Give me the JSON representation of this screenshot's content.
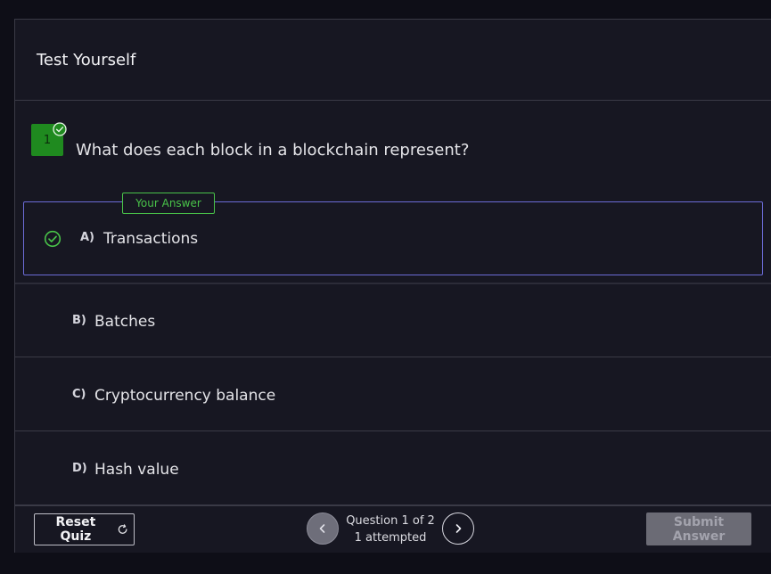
{
  "quiz": {
    "title": "Test Yourself"
  },
  "question": {
    "number": "1",
    "text": "What does each block in a blockchain represent?",
    "answer_tag": "Your Answer"
  },
  "options": [
    {
      "letter": "A)",
      "text": "Transactions",
      "selected": true
    },
    {
      "letter": "B)",
      "text": "Batches"
    },
    {
      "letter": "C)",
      "text": "Cryptocurrency balance"
    },
    {
      "letter": "D)",
      "text": "Hash value"
    }
  ],
  "footer": {
    "reset_label": "Reset Quiz",
    "progress_line1": "Question 1 of 2",
    "progress_line2": "1 attempted",
    "submit_label": "Submit Answer"
  },
  "colors": {
    "accent_green": "#49c349",
    "badge_green": "#1f8a1f",
    "selected_border": "#6b6bd6"
  },
  "icons": {
    "badge_check": "check-circle-icon",
    "option_check": "check-circle-icon",
    "reset": "refresh-icon",
    "prev": "chevron-left-icon",
    "next": "chevron-right-icon"
  }
}
